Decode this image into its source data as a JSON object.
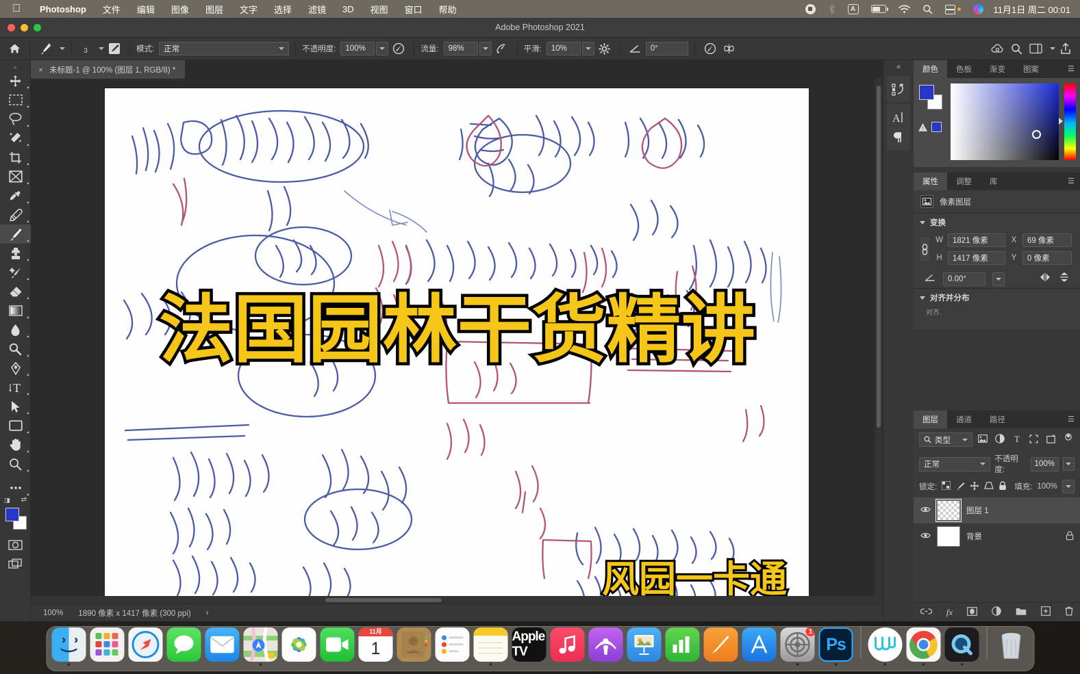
{
  "menubar": {
    "apple": "apple-logo",
    "app": "Photoshop",
    "items": [
      "文件",
      "编辑",
      "图像",
      "图层",
      "文字",
      "选择",
      "滤镜",
      "3D",
      "视图",
      "窗口",
      "帮助"
    ],
    "status_icons": [
      "screen-record-icon",
      "bluetooth-icon",
      "input-source-icon",
      "battery-icon",
      "wifi-icon",
      "search-icon",
      "control-center-icon",
      "siri-icon"
    ],
    "input_source_label": "A",
    "clock": "11月1日 周二  00:01"
  },
  "window": {
    "title": "Adobe Photoshop 2021"
  },
  "options_bar": {
    "home_icon": "home-icon",
    "brush_icon": "brush-icon",
    "brush_size": "3",
    "brush_panel_icon": "brush-settings-icon",
    "mode_label": "模式:",
    "mode_value": "正常",
    "opacity_label": "不透明度:",
    "opacity_value": "100%",
    "pressure_opacity_icon": "pressure-opacity-icon",
    "flow_label": "流量:",
    "flow_value": "98%",
    "airbrush_icon": "airbrush-icon",
    "smoothing_label": "平滑:",
    "smoothing_value": "10%",
    "smoothing_gear_icon": "gear-icon",
    "angle_icon": "angle-icon",
    "angle_value": "0°",
    "pressure_size_icon": "pressure-size-icon",
    "symmetry_icon": "symmetry-butterfly-icon",
    "search_icon": "search-icon",
    "share_icon": "share-icon",
    "workspace_icon": "workspace-icon",
    "cloud_icon": "cloud-documents-icon"
  },
  "toolbar": {
    "tools": [
      {
        "name": "move-tool",
        "icon": "move"
      },
      {
        "name": "marquee-tool",
        "icon": "marquee"
      },
      {
        "name": "lasso-tool",
        "icon": "lasso"
      },
      {
        "name": "quick-select-tool",
        "icon": "wand"
      },
      {
        "name": "crop-tool",
        "icon": "crop"
      },
      {
        "name": "frame-tool",
        "icon": "frame"
      },
      {
        "name": "eyedropper-tool",
        "icon": "eyedropper"
      },
      {
        "name": "healing-brush-tool",
        "icon": "healing"
      },
      {
        "name": "brush-tool",
        "icon": "brush",
        "active": true
      },
      {
        "name": "clone-stamp-tool",
        "icon": "stamp"
      },
      {
        "name": "history-brush-tool",
        "icon": "history-brush"
      },
      {
        "name": "eraser-tool",
        "icon": "eraser"
      },
      {
        "name": "gradient-tool",
        "icon": "gradient"
      },
      {
        "name": "blur-tool",
        "icon": "blur"
      },
      {
        "name": "dodge-tool",
        "icon": "dodge"
      },
      {
        "name": "pen-tool",
        "icon": "pen"
      },
      {
        "name": "type-tool",
        "icon": "type"
      },
      {
        "name": "path-select-tool",
        "icon": "path-select"
      },
      {
        "name": "shape-tool",
        "icon": "rectangle"
      },
      {
        "name": "hand-tool",
        "icon": "hand"
      },
      {
        "name": "zoom-tool",
        "icon": "zoom"
      },
      {
        "name": "edit-toolbar-tool",
        "icon": "ellipsis"
      }
    ],
    "foreground_color": "#2836c8",
    "background_color": "#ffffff",
    "quickmask_icon": "quick-mask-icon",
    "screenmode_icon": "screen-mode-icon"
  },
  "document": {
    "tab_title": "未标题-1 @ 100% (图层 1, RGB/8) *",
    "close_icon": "close-icon",
    "canvas_title": "法国园林干货精讲",
    "canvas_subtitle": "风园一卡通",
    "title_color": "#f5c518",
    "title_outline_color": "#000000"
  },
  "statusbar": {
    "zoom": "100%",
    "dimensions": "1890 像素 x 1417 像素 (300 ppi)",
    "arrow": "›"
  },
  "rail": {
    "collapse_icon": "collapse-panels-icon",
    "items": [
      "history-icon",
      "character-icon",
      "paragraph-icon"
    ]
  },
  "color_panel": {
    "tabs": [
      {
        "label": "颜色",
        "active": true
      },
      {
        "label": "色板",
        "active": false
      },
      {
        "label": "渐变",
        "active": false
      },
      {
        "label": "图案",
        "active": false
      }
    ],
    "menu_icon": "panel-menu-icon",
    "foreground_color": "#2836c8",
    "background_color": "#ffffff",
    "gamut_warning_icon": "gamut-warning-icon",
    "web_safe_swatch": "#2836c8"
  },
  "properties_panel": {
    "tabs": [
      {
        "label": "属性",
        "active": true
      },
      {
        "label": "调整",
        "active": false
      },
      {
        "label": "库",
        "active": false
      }
    ],
    "menu_icon": "panel-menu-icon",
    "layer_type_icon": "pixel-layer-icon",
    "layer_type_label": "像素图层",
    "transform_section": "变换",
    "w_label": "W",
    "w_value": "1821 像素",
    "x_label": "X",
    "x_value": "69 像素",
    "h_label": "H",
    "h_value": "1417 像素",
    "y_label": "Y",
    "y_value": "0 像素",
    "link_icon": "link-constrain-icon",
    "angle_icon": "angle-icon",
    "angle_value": "0.00°",
    "flip_h_icon": "flip-horizontal-icon",
    "flip_v_icon": "flip-vertical-icon",
    "align_section": "对齐并分布",
    "align_note": "对齐."
  },
  "layers_panel": {
    "tabs": [
      {
        "label": "图层",
        "active": true
      },
      {
        "label": "通道",
        "active": false
      },
      {
        "label": "路径",
        "active": false
      }
    ],
    "menu_icon": "panel-menu-icon",
    "filter_icon": "search-icon",
    "filter_label": "类型",
    "filter_type_icons": [
      "pixel-filter-icon",
      "adjustment-filter-icon",
      "type-filter-icon",
      "shape-filter-icon",
      "smart-object-filter-icon"
    ],
    "filter_toggle_icon": "filter-toggle-icon",
    "blend_mode": "正常",
    "opacity_label": "不透明度:",
    "opacity_value": "100%",
    "lock_label": "锁定:",
    "lock_icons": [
      "lock-transparent-icon",
      "lock-image-icon",
      "lock-position-icon",
      "lock-artboard-icon",
      "lock-all-icon"
    ],
    "fill_label": "填充:",
    "fill_value": "100%",
    "layers": [
      {
        "name": "图层 1",
        "visible": true,
        "thumb": "checker",
        "selected": true,
        "locked": false
      },
      {
        "name": "背景",
        "visible": true,
        "thumb": "white",
        "selected": false,
        "locked": true
      }
    ],
    "footer_icons": [
      "link-layers-icon",
      "layer-style-fx-icon",
      "layer-mask-icon",
      "adjustment-layer-icon",
      "new-group-icon",
      "new-layer-icon",
      "delete-layer-icon"
    ]
  },
  "dock": {
    "items": [
      {
        "name": "finder",
        "label": "Finder",
        "running": true
      },
      {
        "name": "launchpad",
        "label": "启动台",
        "running": false
      },
      {
        "name": "safari",
        "label": "Safari",
        "running": false
      },
      {
        "name": "messages",
        "label": "信息",
        "running": false
      },
      {
        "name": "mail",
        "label": "邮件",
        "running": false
      },
      {
        "name": "maps",
        "label": "地图",
        "running": true
      },
      {
        "name": "photos",
        "label": "照片",
        "running": false
      },
      {
        "name": "facetime",
        "label": "FaceTime",
        "running": false
      },
      {
        "name": "calendar",
        "label": "日历",
        "running": false,
        "month": "11月",
        "day": "1"
      },
      {
        "name": "contacts",
        "label": "通讯录",
        "running": false
      },
      {
        "name": "reminders",
        "label": "提醒事项",
        "running": false
      },
      {
        "name": "notes",
        "label": "备忘录",
        "running": true
      },
      {
        "name": "appletv",
        "label": "Apple TV",
        "running": false
      },
      {
        "name": "music",
        "label": "音乐",
        "running": false
      },
      {
        "name": "podcasts",
        "label": "播客",
        "running": false
      },
      {
        "name": "keynote",
        "label": "Keynote",
        "running": false
      },
      {
        "name": "numbers",
        "label": "Numbers",
        "running": false
      },
      {
        "name": "pages",
        "label": "Pages",
        "running": false
      },
      {
        "name": "appstore",
        "label": "App Store",
        "running": false
      },
      {
        "name": "systemsettings",
        "label": "系统偏好设置",
        "running": true,
        "badge": "1"
      },
      {
        "name": "photoshop",
        "label": "Ps",
        "running": true
      },
      {
        "name": "wps",
        "label": "WPS",
        "running": true
      },
      {
        "name": "chrome",
        "label": "Chrome",
        "running": true
      },
      {
        "name": "quicktime",
        "label": "QuickTime",
        "running": true
      },
      {
        "name": "trash",
        "label": "废纸篓",
        "running": false
      }
    ]
  }
}
